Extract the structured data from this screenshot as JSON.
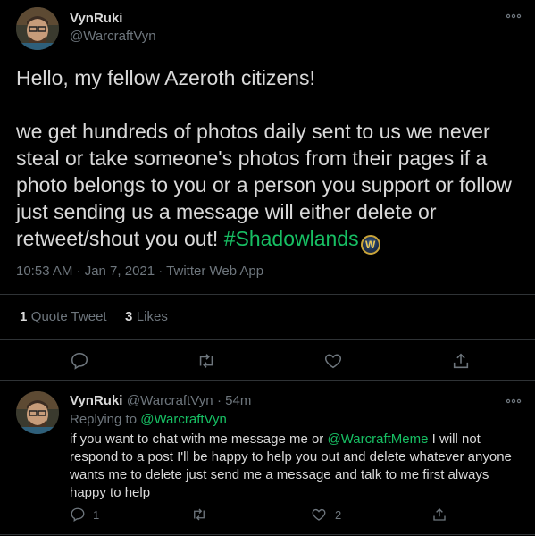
{
  "tweet": {
    "author_name": "VynRuki",
    "author_handle": "@WarcraftVyn",
    "line1": "Hello, my fellow Azeroth citizens!",
    "body_lines": [
      "we get hundreds of photos daily sent to us we never",
      "steal or take someone's photos from their pages if a",
      "photo belongs to you or a person you support or follow",
      "just sending us a message will either delete or"
    ],
    "last_line_prefix": "retweet/shout you out! ",
    "hashtag": "#Shadowlands",
    "hashtag_badge_letter": "W",
    "timestamp": "10:53 AM · Jan 7, 2021 · Twitter Web App",
    "stats": {
      "quote_count": "1",
      "quote_label": "Quote Tweet",
      "like_count": "3",
      "like_label": "Likes"
    }
  },
  "reply": {
    "author_name": "VynRuki",
    "author_handle": "@WarcraftVyn",
    "time": "· 54m",
    "replying_to_label": "Replying to",
    "replying_to_handle": "@WarcraftVyn",
    "text_prefix": "if you want to chat with me message me or ",
    "mention": "@WarcraftMeme",
    "text_suffix_line1": " I will not",
    "text_lines": [
      "respond to a post I'll be happy to help you out and delete whatever anyone",
      "wants me to delete just send me a message and talk to me first always",
      "happy to help"
    ],
    "reply_count": "1",
    "like_count": "2"
  },
  "icons": [
    "more-icon",
    "reply-icon",
    "retweet-icon",
    "like-icon",
    "share-icon"
  ],
  "colors": {
    "background": "#000000",
    "text": "#d9d9d9",
    "muted": "#6e767d",
    "hashtag": "#17bf63",
    "divider": "#2f3336"
  }
}
